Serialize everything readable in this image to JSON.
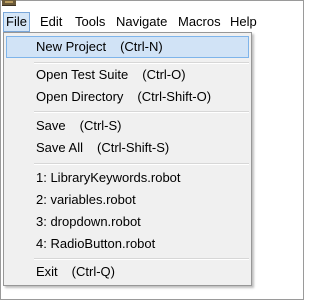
{
  "menubar": {
    "items": [
      "File",
      "Edit",
      "Tools",
      "Navigate",
      "Macros",
      "Help"
    ]
  },
  "file_menu": {
    "new_project": {
      "label": "New Project",
      "shortcut": "(Ctrl-N)"
    },
    "open_test_suite": {
      "label": "Open Test Suite",
      "shortcut": "(Ctrl-O)"
    },
    "open_directory": {
      "label": "Open Directory",
      "shortcut": "(Ctrl-Shift-O)"
    },
    "save": {
      "label": "Save",
      "shortcut": "(Ctrl-S)"
    },
    "save_all": {
      "label": "Save All",
      "shortcut": "(Ctrl-Shift-S)"
    },
    "recent": [
      "1: LibraryKeywords.robot",
      "2: variables.robot",
      "3: dropdown.robot",
      "4: RadioButton.robot"
    ],
    "exit": {
      "label": "Exit",
      "shortcut": "(Ctrl-Q)"
    }
  },
  "colors": {
    "highlight": "#d1e3f6",
    "highlight_border": "#7eb4ea",
    "menu_background": "#f0f0f0"
  }
}
